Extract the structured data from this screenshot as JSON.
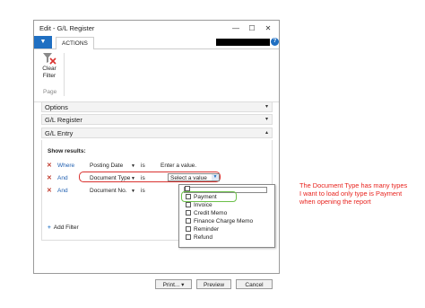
{
  "window": {
    "title": "Edit - G/L Register",
    "minimize": "—",
    "maximize": "☐",
    "close": "✕"
  },
  "ribbon": {
    "app_menu": "▼",
    "tab_actions": "ACTIONS",
    "help": "?",
    "clear_filter": [
      "Clear",
      "Filter"
    ],
    "group_label": "Page"
  },
  "sections": [
    {
      "label": "Options",
      "chevron": "▾"
    },
    {
      "label": "G/L Register",
      "chevron": "▾"
    },
    {
      "label": "G/L Entry",
      "chevron": "▴"
    }
  ],
  "entry": {
    "show_results": "Show results:",
    "filters": [
      {
        "conj": "Where",
        "field": "Posting Date",
        "is": "is",
        "value": "Enter a value."
      },
      {
        "conj": "And",
        "field": "Document Type",
        "is": "is",
        "value": "Select a value"
      },
      {
        "conj": "And",
        "field": "Document No.",
        "is": "is",
        "value": ""
      }
    ],
    "add_filter": "Add Filter"
  },
  "dropdown": {
    "options": [
      {
        "label": "",
        "checked": false
      },
      {
        "label": "Payment",
        "checked": false
      },
      {
        "label": "Invoice",
        "checked": false
      },
      {
        "label": "Credit Memo",
        "checked": false
      },
      {
        "label": "Finance Charge Memo",
        "checked": false
      },
      {
        "label": "Reminder",
        "checked": false
      },
      {
        "label": "Refund",
        "checked": false
      }
    ]
  },
  "buttons": {
    "print": "Print...",
    "print_arrow": "▾",
    "preview": "Preview",
    "cancel": "Cancel"
  },
  "annotation": "The Document Type has many types I want to load only type is Payment when opening the report",
  "colors": {
    "accent": "#1f6fc2",
    "annotation_red": "#e8231e",
    "highlight_green": "#6cc04a",
    "oval_red": "#d9322f"
  }
}
